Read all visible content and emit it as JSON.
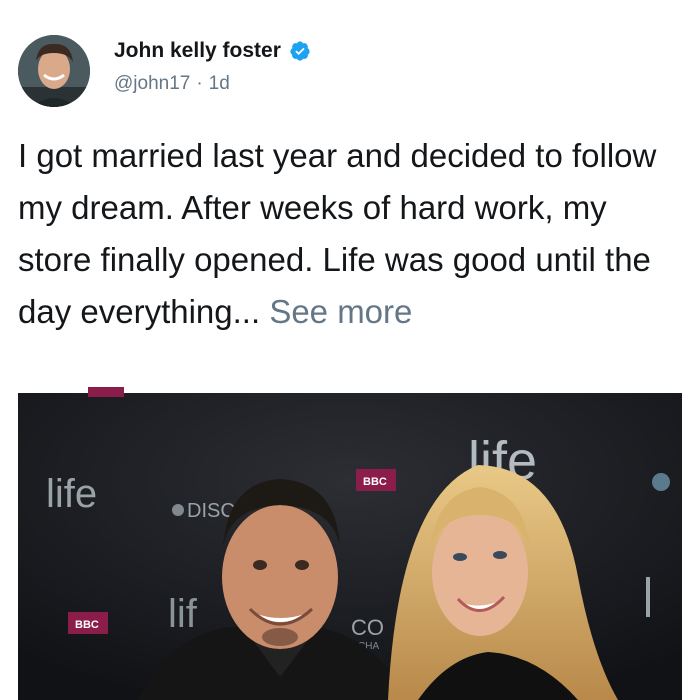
{
  "tweet": {
    "author": {
      "display_name": "John kelly foster",
      "handle": "@john17",
      "verified": true,
      "avatar_icon": "avatar-photo"
    },
    "time_separator": "·",
    "time": "1d",
    "text": "I got married last year and decided to follow my dream. After weeks of hard work, my store finally opened. Life was good until the day everything...",
    "see_more_label": "See more",
    "colors": {
      "text": "#14171a",
      "secondary": "#657786",
      "verified_blue": "#1da1f2"
    }
  },
  "media": {
    "backdrop_text": {
      "life_1": "life",
      "life_2": "life",
      "life_3": "lif",
      "disc": "DISC",
      "bbc_1": "BBC",
      "bbc_2": "BBC",
      "co": "CO",
      "cha": "CHA"
    }
  }
}
